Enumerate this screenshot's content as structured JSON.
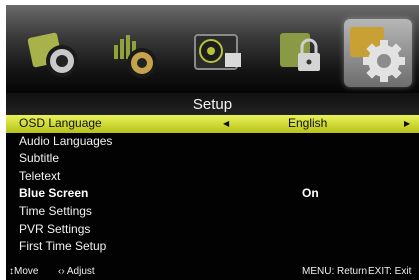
{
  "icons": [
    {
      "name": "picture-icon"
    },
    {
      "name": "sound-icon"
    },
    {
      "name": "channel-icon"
    },
    {
      "name": "lock-icon"
    },
    {
      "name": "setup-gear-icon",
      "selected": true
    }
  ],
  "title": "Setup",
  "menu": [
    {
      "label": "OSD Language",
      "value": "English",
      "selected": true
    },
    {
      "label": "Audio Languages",
      "value": ""
    },
    {
      "label": "Subtitle",
      "value": ""
    },
    {
      "label": "Teletext",
      "value": ""
    },
    {
      "label": "Blue Screen",
      "value": "On"
    },
    {
      "label": "Time Settings",
      "value": ""
    },
    {
      "label": "PVR Settings",
      "value": ""
    },
    {
      "label": "First Time Setup",
      "value": ""
    }
  ],
  "footer": {
    "move": "↕Move",
    "adjust": "‹› Adjust",
    "menu_return": "MENU: Return",
    "exit": "EXIT: Exit"
  },
  "colors": {
    "highlight": "#d7e23a",
    "background": "#020202",
    "text": "#f1f1f1"
  }
}
